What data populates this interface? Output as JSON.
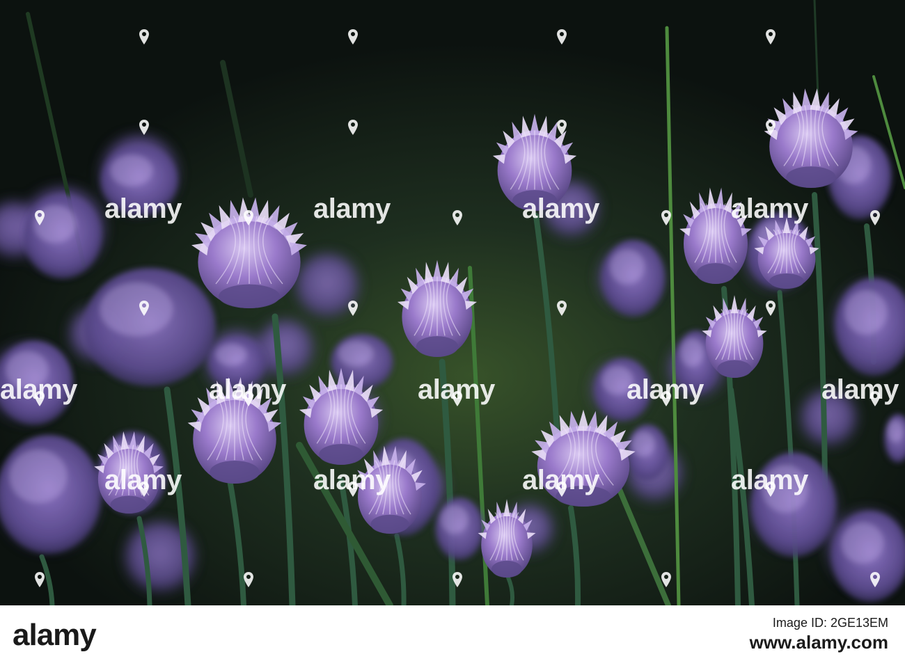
{
  "photo": {
    "subject": "chive-flowers",
    "palette": {
      "background_dark": "#0f1612",
      "background_mid": "#1d2a1f",
      "stem_green": "#2f5a40",
      "leaf_green": "#4e8b3e",
      "flower_purple": "#8e6bc2",
      "flower_light": "#c7b1ea",
      "flower_dark": "#5b4a8a"
    }
  },
  "watermark": {
    "text": "alamy"
  },
  "footer": {
    "logo": "alamy",
    "image_id": "Image ID: 2GE13EM",
    "site": "www.alamy.com"
  }
}
